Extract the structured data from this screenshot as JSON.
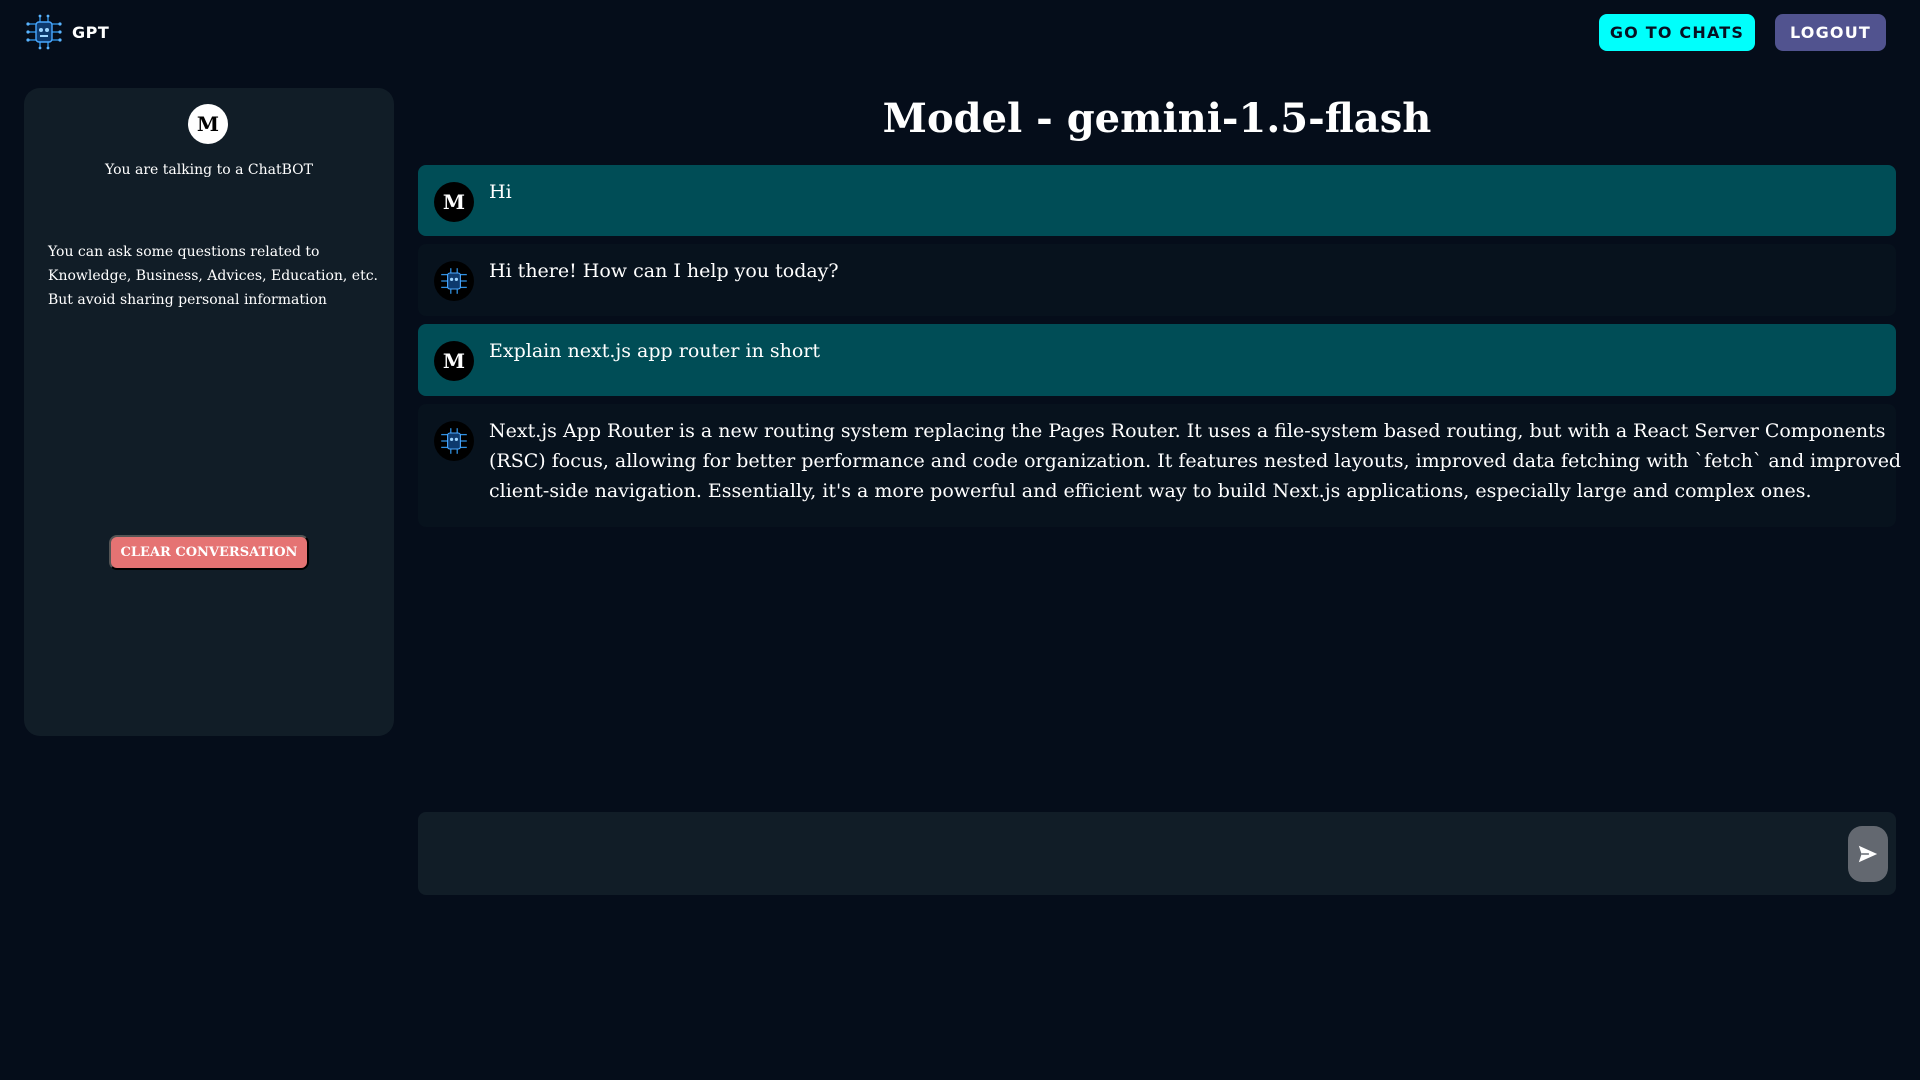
{
  "header": {
    "brand_text": "GPT",
    "logo_icon": "robot-circuit-icon",
    "go_to_chats_label": "GO TO CHATS",
    "logout_label": "LOGOUT"
  },
  "sidebar": {
    "avatar_letter": "M",
    "subtitle": "You are talking to a ChatBOT",
    "info_lines": [
      "You can ask some questions related to",
      "Knowledge, Business, Advices, Education, etc.",
      "But avoid sharing personal information"
    ],
    "clear_label": "CLEAR CONVERSATION"
  },
  "chat": {
    "title": "Model - gemini-1.5-flash",
    "messages": [
      {
        "role": "user",
        "avatar": "M",
        "lines": [
          "Hi"
        ]
      },
      {
        "role": "assistant",
        "avatar_icon": "robot-circuit-icon",
        "lines": [
          "Hi there! How can I help you today?"
        ]
      },
      {
        "role": "user",
        "avatar": "M",
        "lines": [
          "Explain next.js app router in short"
        ]
      },
      {
        "role": "assistant",
        "avatar_icon": "robot-circuit-icon",
        "lines": [
          "Next.js App Router is a new routing system replacing the Pages Router. It uses a file-system based routing, but with a React Server Components",
          "(RSC) focus, allowing for better performance and code organization. It features nested layouts, improved data fetching with `fetch` and improved",
          "client-side navigation. Essentially, it's a more powerful and efficient way to build Next.js applications, especially large and complex ones."
        ]
      }
    ]
  },
  "input": {
    "value": "",
    "placeholder": "",
    "send_icon": "send-icon"
  },
  "colors": {
    "background": "#050d1a",
    "panel": "#111d27",
    "user_message": "#004d56",
    "assistant_message": "#07121d",
    "chats_button": "#00fffc",
    "logout_button": "#51538f",
    "clear_button": "#e57373"
  }
}
